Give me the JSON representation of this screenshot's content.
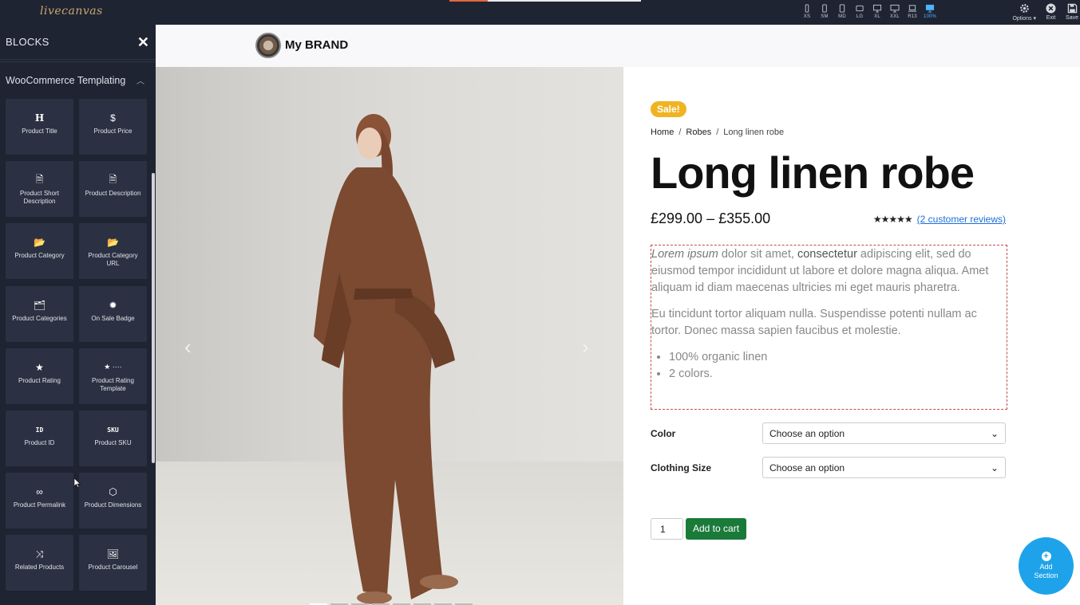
{
  "app": {
    "logo_text": "livecanvas"
  },
  "devices": [
    {
      "label": "XS",
      "icon": "phone-icon"
    },
    {
      "label": "SM",
      "icon": "phone-icon"
    },
    {
      "label": "MD",
      "icon": "tablet-icon"
    },
    {
      "label": "LG",
      "icon": "tablet-landscape-icon"
    },
    {
      "label": "XL",
      "icon": "desktop-icon"
    },
    {
      "label": "XXL",
      "icon": "desktop-icon"
    },
    {
      "label": "R13",
      "icon": "laptop-icon"
    },
    {
      "label": "100%",
      "icon": "monitor-icon",
      "active": true
    }
  ],
  "toolbar": {
    "options_label": "Options ▾",
    "exit_label": "Exit",
    "save_label": "Save"
  },
  "sidebar": {
    "title": "BLOCKS",
    "section_label": "WooCommerce Templating",
    "blocks": [
      {
        "label": "Product Title",
        "icon": "heading-icon",
        "glyph": "H"
      },
      {
        "label": "Product Price",
        "icon": "dollar-icon",
        "glyph": "$"
      },
      {
        "label": "Product Short Description",
        "icon": "document-icon",
        "glyph": "🗎"
      },
      {
        "label": "Product Description",
        "icon": "document-filled-icon",
        "glyph": "🗎"
      },
      {
        "label": "Product Category",
        "icon": "folder-open-icon",
        "glyph": "📂"
      },
      {
        "label": "Product Category URL",
        "icon": "folder-link-icon",
        "glyph": "📂"
      },
      {
        "label": "Product Categories",
        "icon": "folders-icon",
        "glyph": "🗂"
      },
      {
        "label": "On Sale Badge",
        "icon": "badge-icon",
        "glyph": "✹"
      },
      {
        "label": "Product Rating",
        "icon": "star-icon",
        "glyph": "★"
      },
      {
        "label": "Product Rating Template",
        "icon": "star-template-icon",
        "glyph": "★ ····"
      },
      {
        "label": "Product ID",
        "icon": "id-icon",
        "glyph": "ID"
      },
      {
        "label": "Product SKU",
        "icon": "sku-icon",
        "glyph": "SKU"
      },
      {
        "label": "Product Permalink",
        "icon": "link-icon",
        "glyph": "∞"
      },
      {
        "label": "Product Dimensions",
        "icon": "cube-icon",
        "glyph": "⬡"
      },
      {
        "label": "Related Products",
        "icon": "shuffle-icon",
        "glyph": "⤨"
      },
      {
        "label": "Product Carousel",
        "icon": "image-icon",
        "glyph": "🖼"
      }
    ]
  },
  "site": {
    "brand_name": "My BRAND"
  },
  "product": {
    "sale_badge": "Sale!",
    "breadcrumb": [
      "Home",
      "Robes",
      "Long linen robe"
    ],
    "breadcrumb_sep": "/",
    "title": "Long linen robe",
    "price": "£299.00 – £355.00",
    "stars": "★★★★★",
    "reviews_link": "(2 customer reviews)",
    "desc_p1_italic": "Lorem ipsum",
    "desc_p1_a": " dolor sit amet, ",
    "desc_p1_bold": "consectetur",
    "desc_p1_b": " adipiscing elit, sed do eiusmod tempor incididunt ut labore et dolore magna aliqua. Amet aliquam id diam maecenas ultricies mi eget mauris pharetra.",
    "desc_p2": "Eu tincidunt tortor aliquam nulla. Suspendisse potenti nullam ac tortor. Donec massa sapien faucibus et molestie.",
    "bullets": [
      "100% organic linen",
      "2 colors."
    ],
    "color_label": "Color",
    "color_value": "Choose an option",
    "size_label": "Clothing Size",
    "size_value": "Choose an option",
    "qty": "1",
    "add_to_cart": "Add to cart"
  },
  "fab": {
    "line1": "Add",
    "line2": "Section"
  },
  "colors": {
    "accent": "#1ea3ea",
    "sale": "#f0b323",
    "cart": "#1a7a3a",
    "sidebar_bg": "#1f2433"
  }
}
